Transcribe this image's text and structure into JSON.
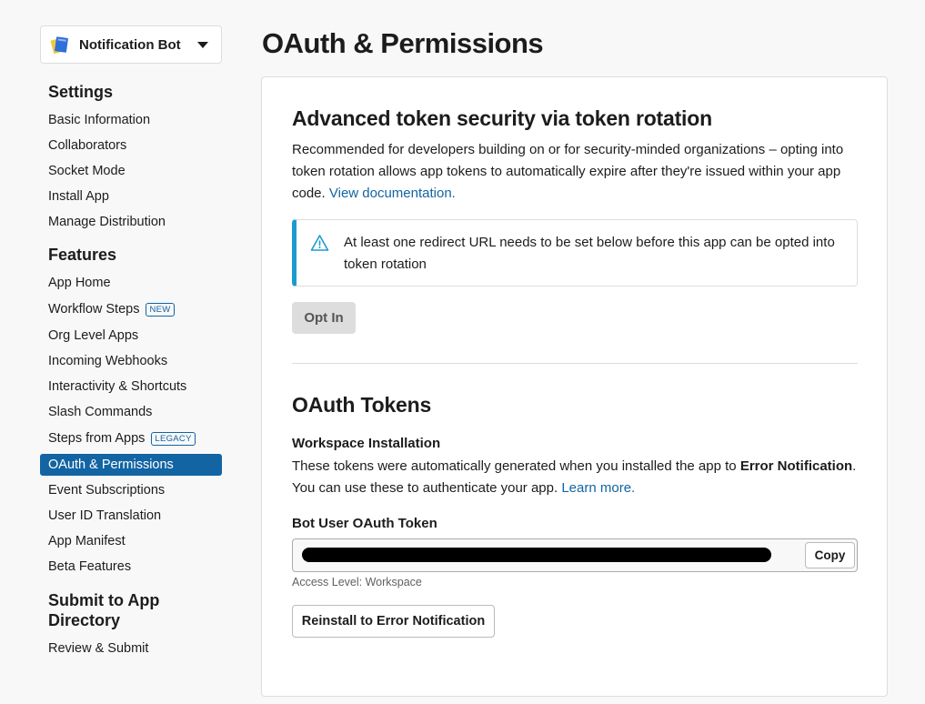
{
  "app": {
    "name": "Notification Bot"
  },
  "page": {
    "title": "OAuth & Permissions"
  },
  "sidebar": {
    "sections": [
      {
        "title": "Settings",
        "items": [
          {
            "label": "Basic Information"
          },
          {
            "label": "Collaborators"
          },
          {
            "label": "Socket Mode"
          },
          {
            "label": "Install App"
          },
          {
            "label": "Manage Distribution"
          }
        ]
      },
      {
        "title": "Features",
        "items": [
          {
            "label": "App Home"
          },
          {
            "label": "Workflow Steps",
            "badge": "NEW"
          },
          {
            "label": "Org Level Apps"
          },
          {
            "label": "Incoming Webhooks"
          },
          {
            "label": "Interactivity & Shortcuts"
          },
          {
            "label": "Slash Commands"
          },
          {
            "label": "Steps from Apps",
            "badge": "LEGACY"
          },
          {
            "label": "OAuth & Permissions",
            "active": true
          },
          {
            "label": "Event Subscriptions"
          },
          {
            "label": "User ID Translation"
          },
          {
            "label": "App Manifest"
          },
          {
            "label": "Beta Features"
          }
        ]
      },
      {
        "title_line1": "Submit to App",
        "title_line2": "Directory",
        "items": [
          {
            "label": "Review & Submit"
          }
        ]
      }
    ]
  },
  "token_rotation": {
    "title": "Advanced token security via token rotation",
    "description": "Recommended for developers building on or for security-minded organizations – opting into token rotation allows app tokens to automatically expire after they're issued within your app code.",
    "doc_link": "View documentation.",
    "alert": "At least one redirect URL needs to be set below before this app can be opted into token rotation",
    "opt_in_label": "Opt In"
  },
  "oauth_tokens": {
    "title": "OAuth Tokens",
    "workspace_heading": "Workspace Installation",
    "desc_part1": "These tokens were automatically generated when you installed the app to ",
    "workspace_name": "Error Notification",
    "desc_part2": ". You can use these to authenticate your app. ",
    "learn_more": "Learn more.",
    "bot_token_label": "Bot User OAuth Token",
    "copy_label": "Copy",
    "access_level": "Access Level: Workspace",
    "reinstall_label": "Reinstall to Error Notification"
  },
  "colors": {
    "accent": "#1264a3",
    "alert_border": "#1d9bd1"
  }
}
